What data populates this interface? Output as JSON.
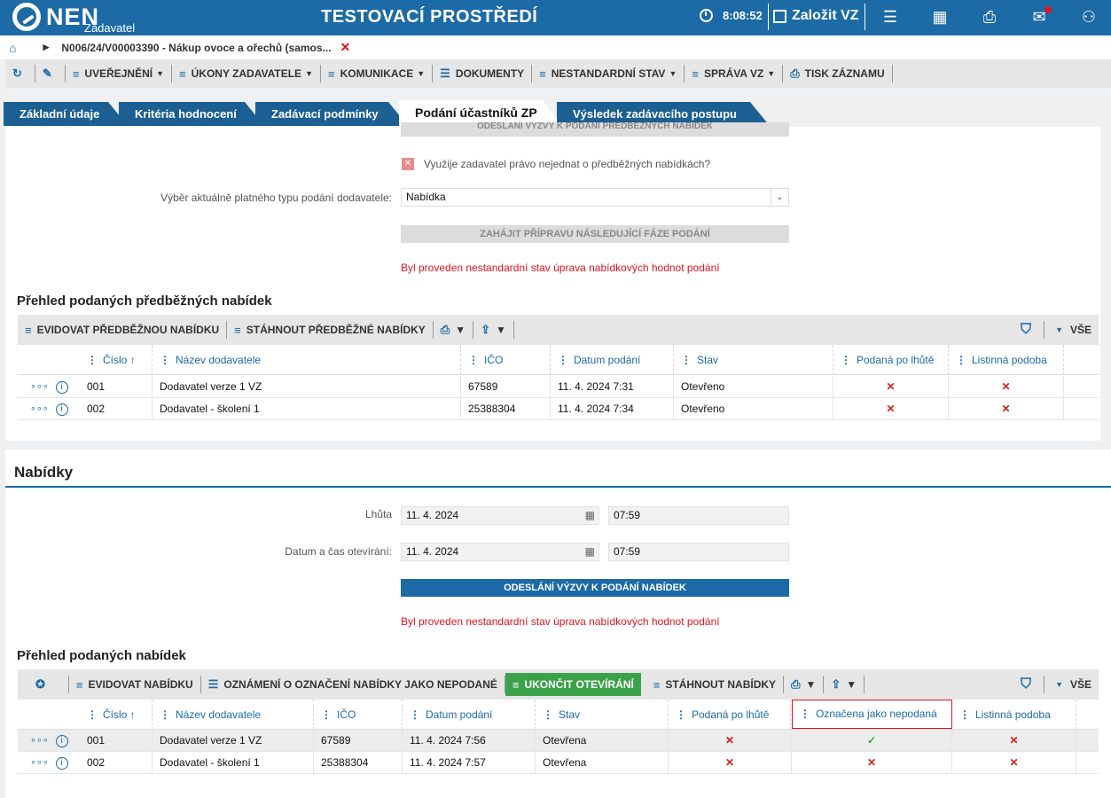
{
  "header": {
    "logo": "NEN",
    "logo_sub": "Zadavatel",
    "env_title": "TESTOVACÍ PROSTŘEDÍ",
    "clock": "8:08:52",
    "create_label": "Založit VZ"
  },
  "breadcrumb": {
    "title": "N006/24/V00003390 - Nákup ovoce a ořechů (samos..."
  },
  "toolbar": {
    "items": [
      "UVEŘEJNĚNÍ",
      "ÚKONY ZADAVATELE",
      "KOMUNIKACE",
      "DOKUMENTY",
      "NESTANDARDNÍ STAV",
      "SPRÁVA VZ",
      "TISK ZÁZNAMU"
    ]
  },
  "tabs": [
    "Základní údaje",
    "Kritéria hodnocení",
    "Zadávací podmínky",
    "Podání účastníků ZP",
    "Výsledek zadávacího postupu"
  ],
  "section1": {
    "top_button": "ODESLÁNÍ VÝZVY K PODÁNÍ PŘEDBĚŽNÝCH NABÍDEK",
    "checkbox_label": "Využije zadavatel právo nejednat o předběžných nabídkách?",
    "select_label": "Výběr aktuálně platného typu podání dodavatele:",
    "select_value": "Nabídka",
    "next_phase_button": "ZAHÁJIT PŘÍPRAVU NÁSLEDUJÍCÍ FÁZE PODÁNÍ",
    "warning": "Byl proveden nestandardní stav úprava nabídkových hodnot podání",
    "grid_title": "Přehled podaných předběžných nabídek",
    "grid_toolbar": [
      "EVIDOVAT PŘEDBĚŽNOU NABÍDKU",
      "STÁHNOUT PŘEDBĚŽNÉ NABÍDKY"
    ],
    "filter_all": "VŠE",
    "columns": [
      "Číslo",
      "Název dodavatele",
      "IČO",
      "Datum podání",
      "Stav",
      "Podaná po lhůtě",
      "Listinná podoba"
    ],
    "rows": [
      {
        "cislo": "001",
        "nazev": "Dodavatel verze 1 VZ",
        "ico": "67589",
        "datum": "11. 4. 2024 7:31",
        "stav": "Otevřeno",
        "po_lhute": "✕",
        "listinna": "✕"
      },
      {
        "cislo": "002",
        "nazev": "Dodavatel - školení 1",
        "ico": "25388304",
        "datum": "11. 4. 2024 7:34",
        "stav": "Otevřeno",
        "po_lhute": "✕",
        "listinna": "✕"
      }
    ]
  },
  "section2": {
    "title": "Nabídky",
    "lhuta_label": "Lhůta",
    "lhuta_date": "11. 4. 2024",
    "lhuta_time": "07:59",
    "otevirani_label": "Datum a čas otevírání:",
    "otevirani_date": "11. 4. 2024",
    "otevirani_time": "07:59",
    "send_button": "ODESLÁNÍ VÝZVY K PODÁNÍ NABÍDEK",
    "warning": "Byl proveden nestandardní stav úprava nabídkových hodnot podání",
    "grid_title": "Přehled podaných nabídek",
    "grid_toolbar": [
      "EVIDOVAT NABÍDKU",
      "OZNÁMENÍ O OZNAČENÍ NABÍDKY JAKO NEPODANÉ",
      "UKONČIT OTEVÍRÁNÍ",
      "STÁHNOUT NABÍDKY"
    ],
    "filter_all": "VŠE",
    "columns": [
      "Číslo",
      "Název dodavatele",
      "IČO",
      "Datum podání",
      "Stav",
      "Podaná po lhůtě",
      "Označena jako nepodaná",
      "Listinná podoba"
    ],
    "rows": [
      {
        "cislo": "001",
        "nazev": "Dodavatel verze 1 VZ",
        "ico": "67589",
        "datum": "11. 4. 2024 7:56",
        "stav": "Otevřena",
        "po_lhute": "✕",
        "nepodana": "✓",
        "listinna": "✕"
      },
      {
        "cislo": "002",
        "nazev": "Dodavatel - školení 1",
        "ico": "25388304",
        "datum": "11. 4. 2024 7:57",
        "stav": "Otevřena",
        "po_lhute": "✕",
        "nepodana": "✕",
        "listinna": "✕"
      }
    ]
  },
  "colors": {
    "primary": "#1c6aa6",
    "warning": "#e0141e",
    "success": "#3aa34a"
  }
}
